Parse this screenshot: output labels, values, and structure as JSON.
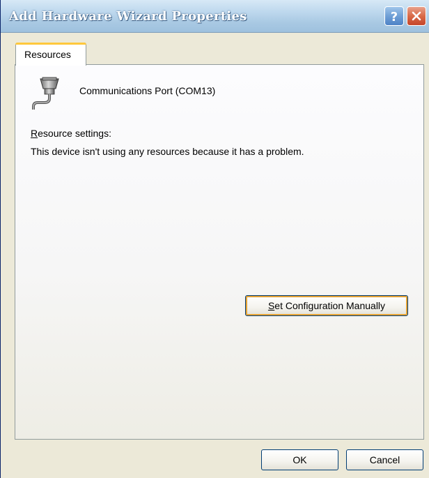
{
  "window": {
    "title": "Add Hardware Wizard Properties",
    "help_glyph": "?",
    "close_glyph": "✕"
  },
  "tabs": [
    {
      "label": "Resources",
      "selected": true
    }
  ],
  "device": {
    "icon": "serial-port-icon",
    "name": "Communications Port (COM13)"
  },
  "resources": {
    "label_accel": "R",
    "label_rest": "esource settings:",
    "message": "This device isn't using any resources because it has a problem."
  },
  "buttons": {
    "set_config_accel": "S",
    "set_config_rest": "et Configuration Manually",
    "ok": "OK",
    "cancel": "Cancel"
  },
  "colors": {
    "face": "#ece9d8",
    "tab_highlight": "#ffc83c",
    "button_border": "#003c74"
  }
}
